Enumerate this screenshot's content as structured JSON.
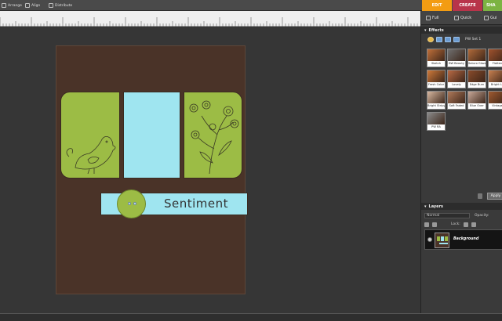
{
  "toolbar": {
    "arrange": "Arrange",
    "align": "Align",
    "distribute": "Distribute"
  },
  "modes": {
    "edit": "EDIT",
    "create": "CREATE",
    "share": "SHA"
  },
  "edit_modes": {
    "full": "Full",
    "quick": "Quick",
    "guided": "Gui"
  },
  "effects": {
    "title": "Effects",
    "set_label": "PW Set 1",
    "thumbnails": [
      {
        "label": "Sketch",
        "color": "#c0703a"
      },
      {
        "label": "BW Beauty",
        "color": "#707070"
      },
      {
        "label": "Saturo Glaze",
        "color": "#b06a3a"
      },
      {
        "label": "Flatten",
        "color": "#a0522d"
      },
      {
        "label": "Fresh Color",
        "color": "#d07a3a"
      },
      {
        "label": "Lovely",
        "color": "#b96a44"
      },
      {
        "label": "Edge Burn",
        "color": "#8a4b2b"
      },
      {
        "label": "Bright Le",
        "color": "#c88050"
      },
      {
        "label": "Bright Stripy",
        "color": "#d8b8a0"
      },
      {
        "label": "Soft Faded",
        "color": "#b07a5a"
      },
      {
        "label": "Blue Over",
        "color": "#c8a898"
      },
      {
        "label": "Vintage",
        "color": "#a05a30"
      },
      {
        "label": "PW RA",
        "color": "#8a8a8a"
      }
    ],
    "apply_label": "Apply"
  },
  "layers": {
    "title": "Layers",
    "blend_mode": "Normal",
    "opacity_label": "Opacity:",
    "lock_label": "Lock:",
    "items": [
      {
        "name": "Background"
      }
    ]
  },
  "canvas": {
    "sentiment_text": "Sentiment"
  },
  "colors": {
    "paper": "#4a3328",
    "green": "#9cbc45",
    "light_blue": "#9fe5f0",
    "edit_tab": "#f39c12",
    "create_tab": "#c0392b",
    "share_tab": "#8bc34a"
  }
}
